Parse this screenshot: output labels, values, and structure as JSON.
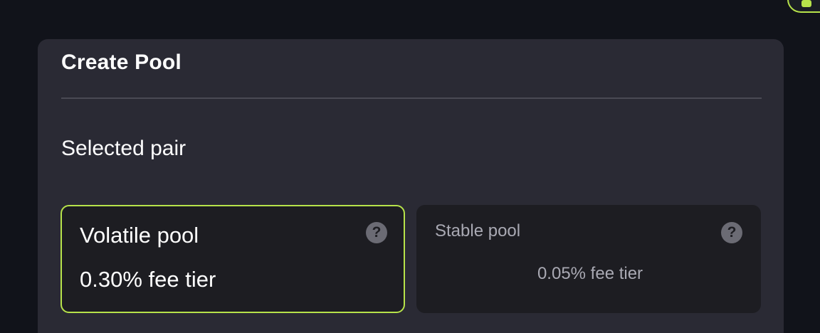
{
  "card": {
    "title": "Create Pool",
    "section_label": "Selected pair"
  },
  "pools": {
    "volatile": {
      "name": "Volatile pool",
      "fee": "0.30% fee tier",
      "help_glyph": "?"
    },
    "stable": {
      "name": "Stable pool",
      "fee": "0.05% fee tier",
      "help_glyph": "?"
    }
  },
  "colors": {
    "accent": "#b7e34a",
    "background": "#11131a",
    "card": "#2a2a34",
    "option": "#1d1d22"
  },
  "icons": {
    "help": "question-circle-icon"
  }
}
